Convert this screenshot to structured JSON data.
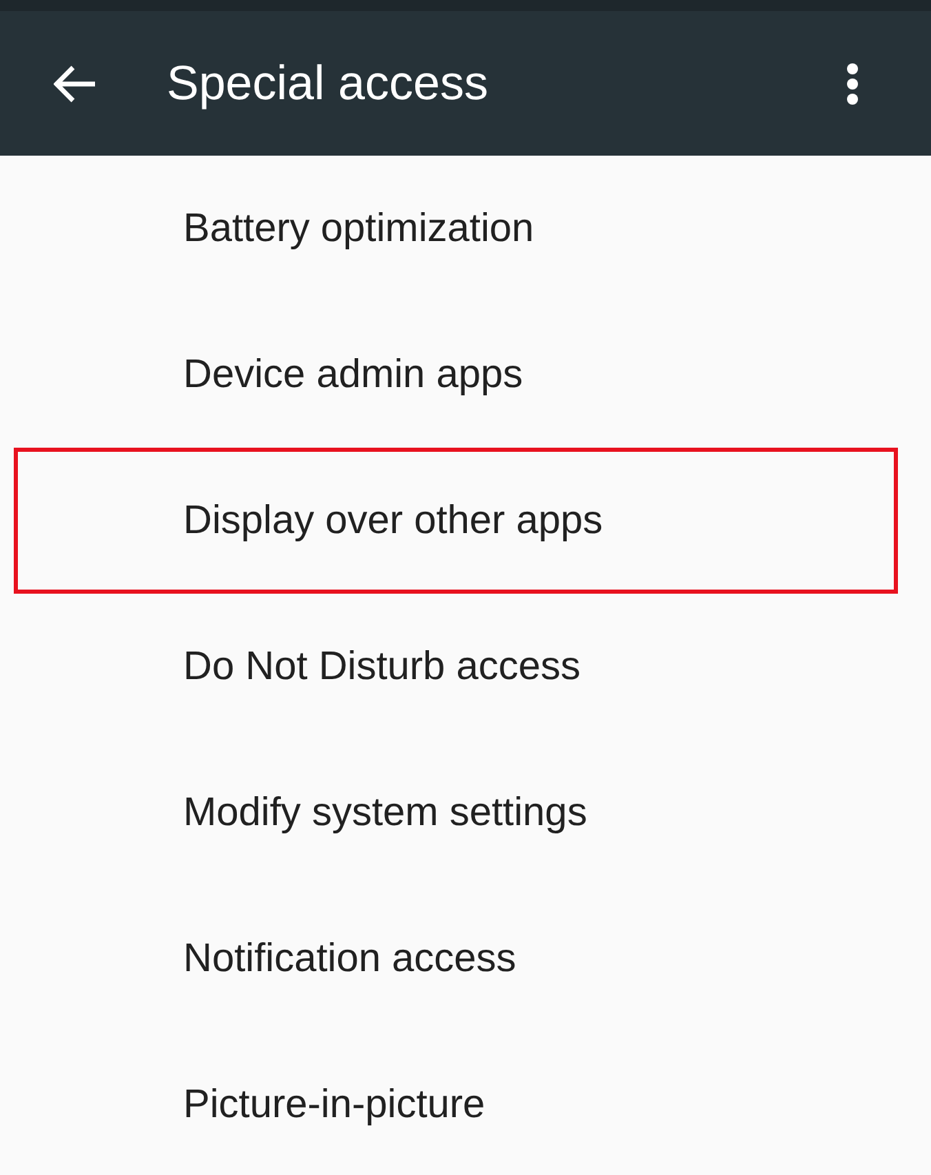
{
  "app_bar": {
    "title": "Special access"
  },
  "items": [
    {
      "label": "Battery optimization",
      "highlighted": false
    },
    {
      "label": "Device admin apps",
      "highlighted": false
    },
    {
      "label": "Display over other apps",
      "highlighted": true
    },
    {
      "label": "Do Not Disturb access",
      "highlighted": false
    },
    {
      "label": "Modify system settings",
      "highlighted": false
    },
    {
      "label": "Notification access",
      "highlighted": false
    },
    {
      "label": "Picture-in-picture",
      "highlighted": false
    }
  ]
}
